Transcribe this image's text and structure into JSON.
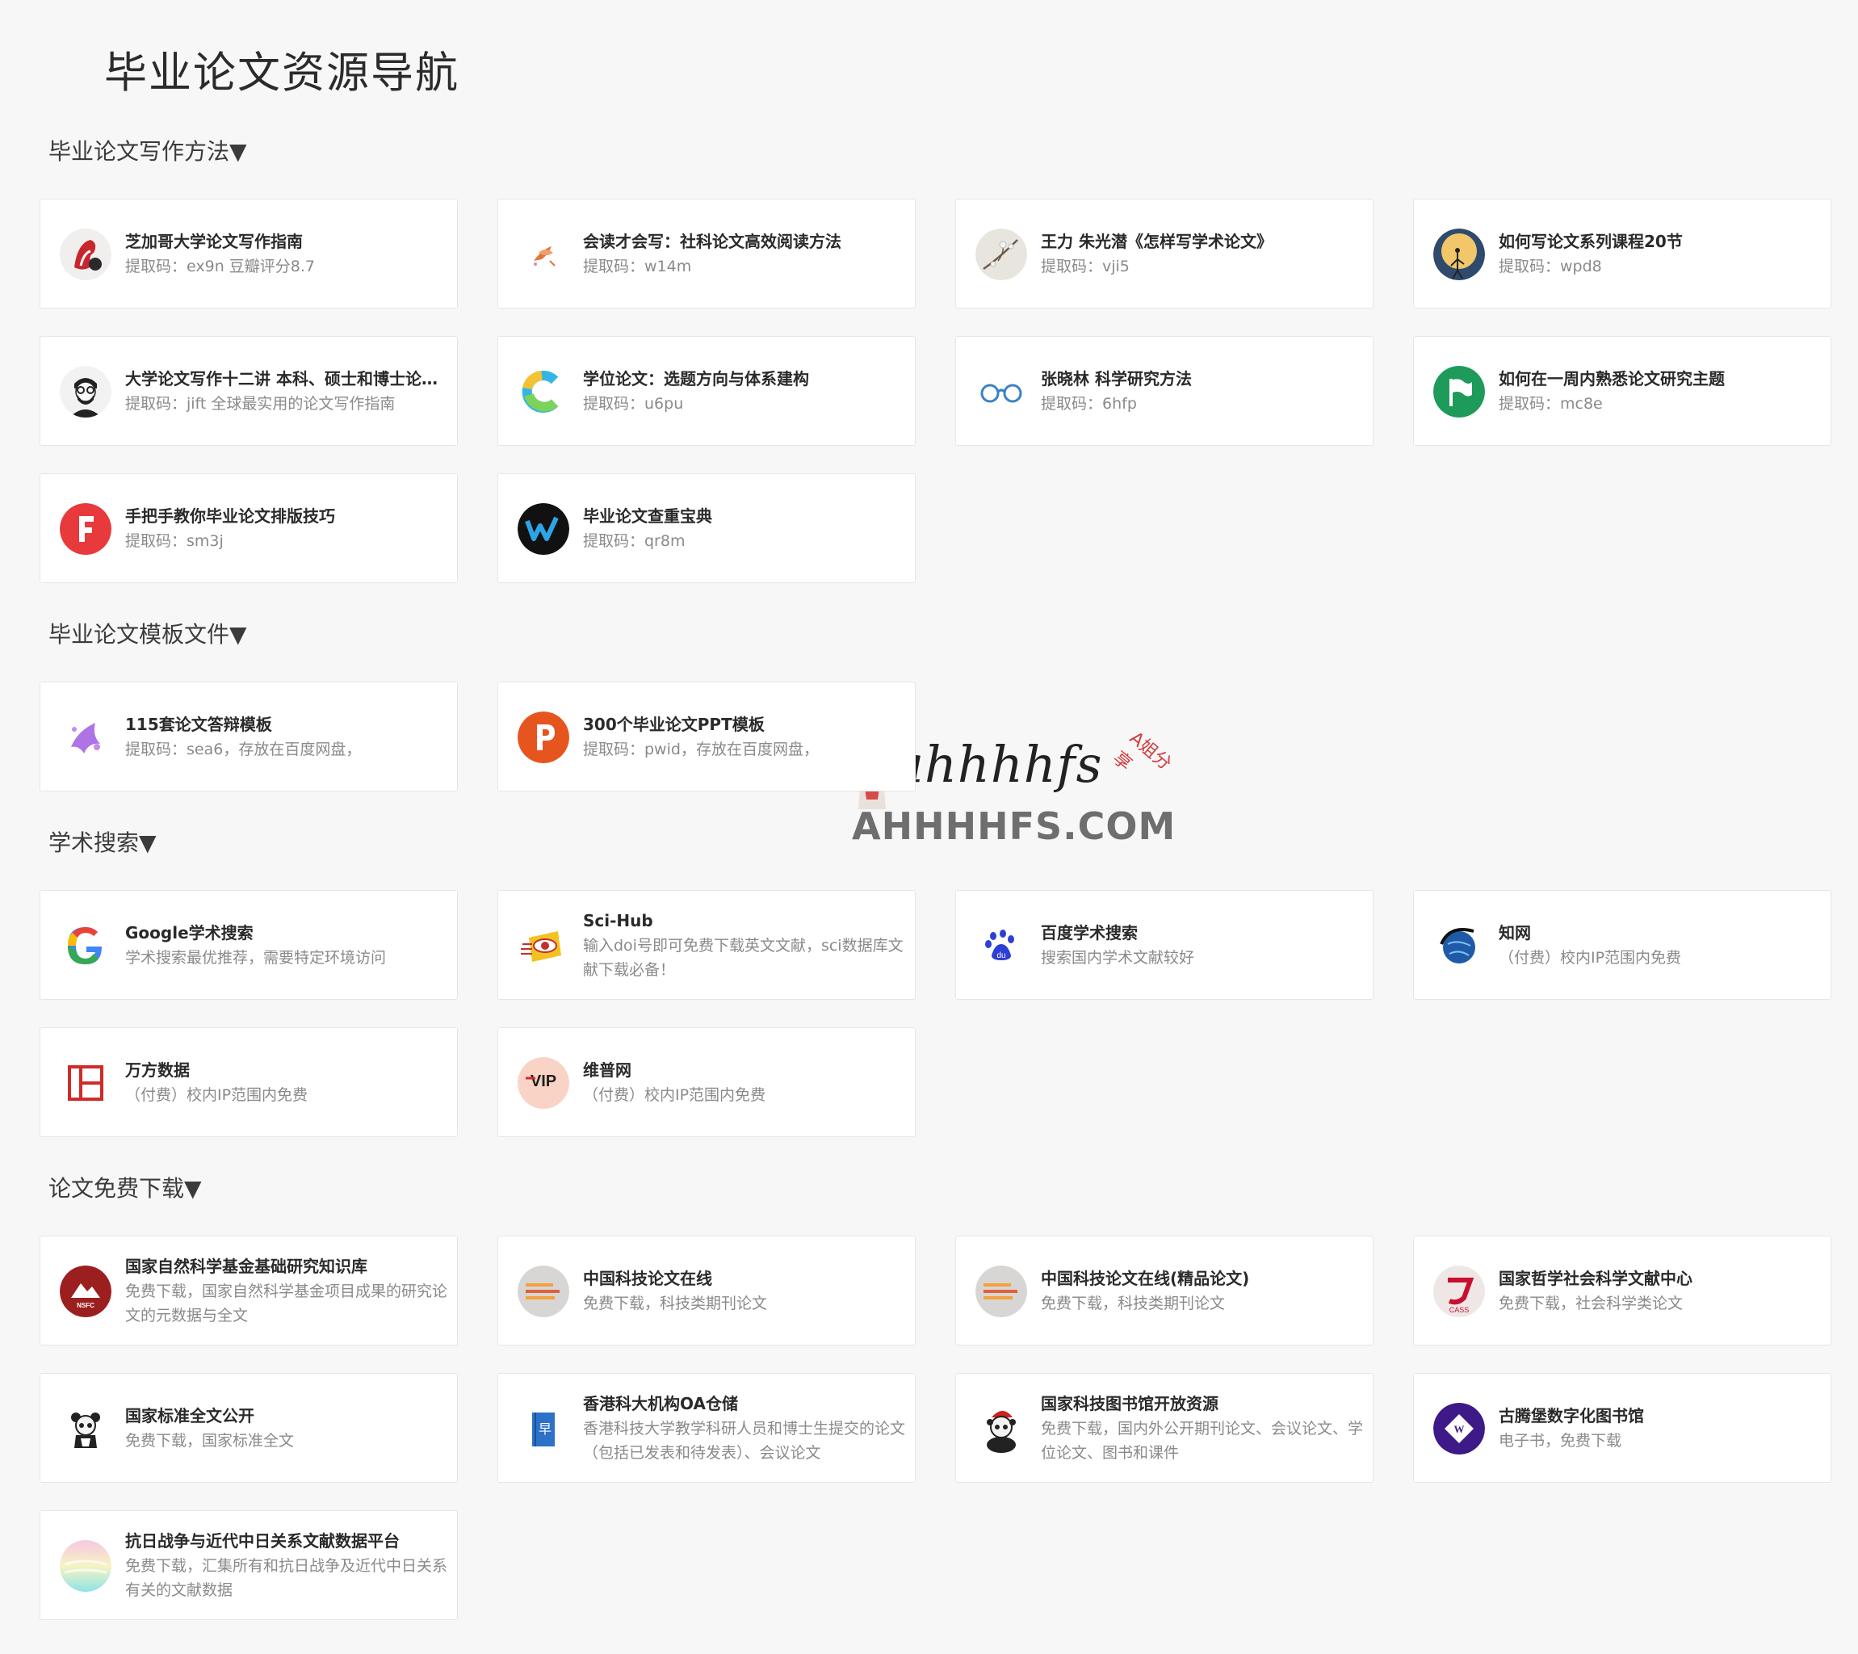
{
  "page_title": "毕业论文资源导航",
  "watermark": {
    "logo_text": "ahhhhfs",
    "tag_text": "A姐分享",
    "domain_text": "AHHHHFS.COM"
  },
  "sections": [
    {
      "title": "毕业论文写作方法▼",
      "cards": [
        {
          "title": "芝加哥大学论文写作指南",
          "desc": "提取码：ex9n 豆瓣评分8.7",
          "icon": "red-swirl-avatar-icon"
        },
        {
          "title": "会读才会写：社科论文高效阅读方法",
          "desc": "提取码：w14m",
          "icon": "koi-fish-icon"
        },
        {
          "title": "王力 朱光潜《怎样写学术论文》",
          "desc": "提取码：vji5",
          "icon": "plum-blossom-icon"
        },
        {
          "title": "如何写论文系列课程20节",
          "desc": "提取码：wpd8",
          "icon": "moon-figure-icon"
        },
        {
          "title": "大学论文写作十二讲 本科、硕士和博士论文写作指南",
          "desc": "提取码：jift 全球最实用的论文写作指南",
          "icon": "bearded-man-icon"
        },
        {
          "title": "学位论文：选题方向与体系建构",
          "desc": "提取码：u6pu",
          "icon": "rainbow-c-icon"
        },
        {
          "title": "张晓林 科学研究方法",
          "desc": "提取码：6hfp",
          "icon": "glasses-icon"
        },
        {
          "title": "如何在一周内熟悉论文研究主题",
          "desc": "提取码：mc8e",
          "icon": "green-flag-icon"
        },
        {
          "title": "手把手教你毕业论文排版技巧",
          "desc": "提取码：sm3j",
          "icon": "letter-f-icon"
        },
        {
          "title": "毕业论文查重宝典",
          "desc": "提取码：qr8m",
          "icon": "letter-w-icon"
        }
      ]
    },
    {
      "title": "毕业论文模板文件▼",
      "cards": [
        {
          "title": "115套论文答辩模板",
          "desc": "提取码：sea6，存放在百度网盘，",
          "icon": "purple-splash-icon"
        },
        {
          "title": "300个毕业论文PPT模板",
          "desc": "提取码：pwid，存放在百度网盘，",
          "icon": "powerpoint-icon"
        }
      ]
    },
    {
      "title": "学术搜索▼",
      "cards": [
        {
          "title": "Google学术搜索",
          "desc": "学术搜索最优推荐，需要特定环境访问",
          "icon": "google-icon"
        },
        {
          "title": "Sci-Hub",
          "desc": "输入doi号即可免费下载英文文献，sci数据库文献下载必备！",
          "icon": "scihub-icon"
        },
        {
          "title": "百度学术搜索",
          "desc": "搜索国内学术文献较好",
          "icon": "baidu-paw-icon"
        },
        {
          "title": "知网",
          "desc": "（付费）校内IP范围内免费",
          "icon": "cnki-globe-icon"
        },
        {
          "title": "万方数据",
          "desc": "（付费）校内IP范围内免费",
          "icon": "wanfang-icon"
        },
        {
          "title": "维普网",
          "desc": "（付费）校内IP范围内免费",
          "icon": "vip-icon"
        }
      ]
    },
    {
      "title": "论文免费下载▼",
      "cards": [
        {
          "title": "国家自然科学基金基础研究知识库",
          "desc": "免费下载，国家自然科学基金项目成果的研究论文的元数据与全文",
          "icon": "nsfc-icon"
        },
        {
          "title": "中国科技论文在线",
          "desc": "免费下载，科技类期刊论文",
          "icon": "paper-lines-icon"
        },
        {
          "title": "中国科技论文在线(精品论文)",
          "desc": "免费下载，科技类期刊论文",
          "icon": "paper-lines-icon"
        },
        {
          "title": "国家哲学社会科学文献中心",
          "desc": "免费下载，社会科学类论文",
          "icon": "cass-icon"
        },
        {
          "title": "国家标准全文公开",
          "desc": "免费下载，国家标准全文",
          "icon": "panda-icon"
        },
        {
          "title": "香港科大机构OA仓储",
          "desc": "香港科技大学教学科研人员和博士生提交的论文（包括已发表和待发表）、会议论文",
          "icon": "blue-book-icon"
        },
        {
          "title": "国家科技图书馆开放资源",
          "desc": "免费下载，国内外公开期刊论文、会议论文、学位论文、图书和课件",
          "icon": "santa-panda-icon"
        },
        {
          "title": "古腾堡数字化图书馆",
          "desc": "电子书，免费下载",
          "icon": "gutenberg-icon"
        },
        {
          "title": "抗日战争与近代中日关系文献数据平台",
          "desc": "免费下载，汇集所有和抗日战争及近代中日关系有关的文献数据",
          "icon": "pastel-sphere-icon"
        }
      ]
    }
  ]
}
